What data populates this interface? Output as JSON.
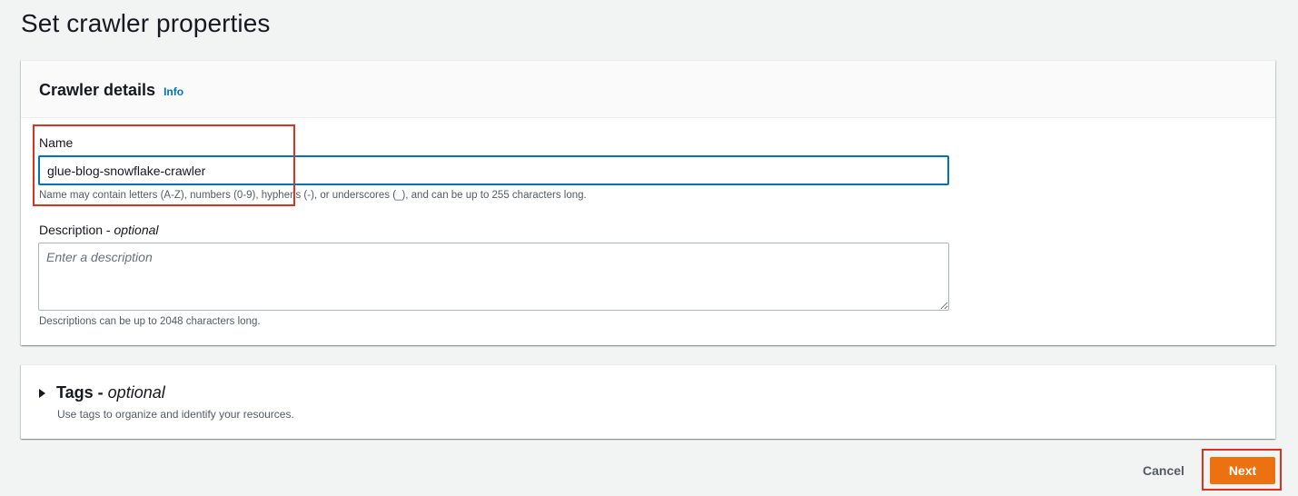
{
  "page": {
    "title": "Set crawler properties"
  },
  "crawler_details": {
    "title": "Crawler details",
    "info_label": "Info",
    "name": {
      "label": "Name",
      "value": "glue-blog-snowflake-crawler",
      "hint": "Name may contain letters (A-Z), numbers (0-9), hyphens (-), or underscores (_), and can be up to 255 characters long."
    },
    "description": {
      "label": "Description - ",
      "label_optional": "optional",
      "value": "",
      "placeholder": "Enter a description",
      "hint": "Descriptions can be up to 2048 characters long."
    }
  },
  "tags": {
    "title": "Tags - ",
    "title_optional": "optional",
    "hint": "Use tags to organize and identify your resources.",
    "expanded": false
  },
  "footer": {
    "cancel_label": "Cancel",
    "next_label": "Next"
  },
  "colors": {
    "accent": "#0073bb",
    "primary_button": "#ec7211",
    "highlight": "#e0301e",
    "background": "#f2f3f3"
  },
  "icons": {
    "tags_toggle": "caret-right-icon"
  }
}
